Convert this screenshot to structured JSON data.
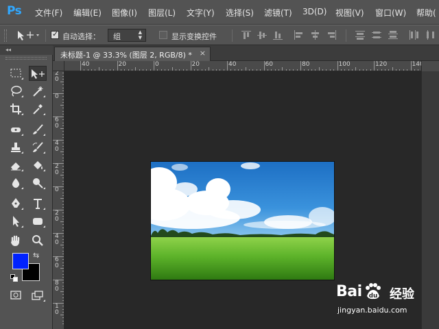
{
  "app": {
    "logo": "Ps",
    "menu": [
      {
        "label": "文件(F)"
      },
      {
        "label": "编辑(E)"
      },
      {
        "label": "图像(I)"
      },
      {
        "label": "图层(L)"
      },
      {
        "label": "文字(Y)"
      },
      {
        "label": "选择(S)"
      },
      {
        "label": "滤镜(T)"
      },
      {
        "label": "3D(D)"
      },
      {
        "label": "视图(V)"
      },
      {
        "label": "窗口(W)"
      },
      {
        "label": "帮助("
      }
    ]
  },
  "options": {
    "tool_icon": "move-tool-icon",
    "auto_select_label": "自动选择：",
    "auto_select_checked": true,
    "auto_select_target": "组",
    "show_transform_label": "显示变换控件",
    "show_transform_checked": false
  },
  "toolbar": {
    "collapse_label": "◂◂",
    "tools": [
      {
        "icon": "rectangular-marquee-icon"
      },
      {
        "icon": "move-tool-icon"
      },
      {
        "icon": "lasso-icon"
      },
      {
        "icon": "magic-wand-icon"
      },
      {
        "icon": "crop-icon"
      },
      {
        "icon": "eyedropper-icon"
      },
      {
        "icon": "spot-healing-icon"
      },
      {
        "icon": "brush-icon"
      },
      {
        "icon": "clone-stamp-icon"
      },
      {
        "icon": "history-brush-icon"
      },
      {
        "icon": "eraser-icon"
      },
      {
        "icon": "paint-bucket-icon"
      },
      {
        "icon": "blur-icon"
      },
      {
        "icon": "dodge-icon"
      },
      {
        "icon": "pen-icon"
      },
      {
        "icon": "type-icon"
      },
      {
        "icon": "path-selection-icon"
      },
      {
        "icon": "shape-icon"
      },
      {
        "icon": "hand-icon"
      },
      {
        "icon": "zoom-icon"
      },
      {
        "icon": "quick-mask-icon"
      },
      {
        "icon": "screen-mode-icon"
      }
    ],
    "foreground_color": "#0022ff",
    "background_color": "#000000"
  },
  "document": {
    "tab_title": "未标题-1 @ 33.3% (图层 2, RGB/8) *",
    "close_label": "×"
  },
  "rulers": {
    "h_labels": [
      "40",
      "20",
      "0",
      "20",
      "40",
      "60",
      "80",
      "100",
      "120",
      "140"
    ],
    "v_labels": [
      "2\n0",
      "0",
      "6\n0",
      "4\n0",
      "2\n0",
      "0",
      "2\n0",
      "4\n0",
      "6\n0",
      "8\n0",
      "1\n0"
    ]
  },
  "watermark": {
    "brand": "Bai",
    "brand_suffix": "经验",
    "url": "jingyan.baidu.com"
  }
}
